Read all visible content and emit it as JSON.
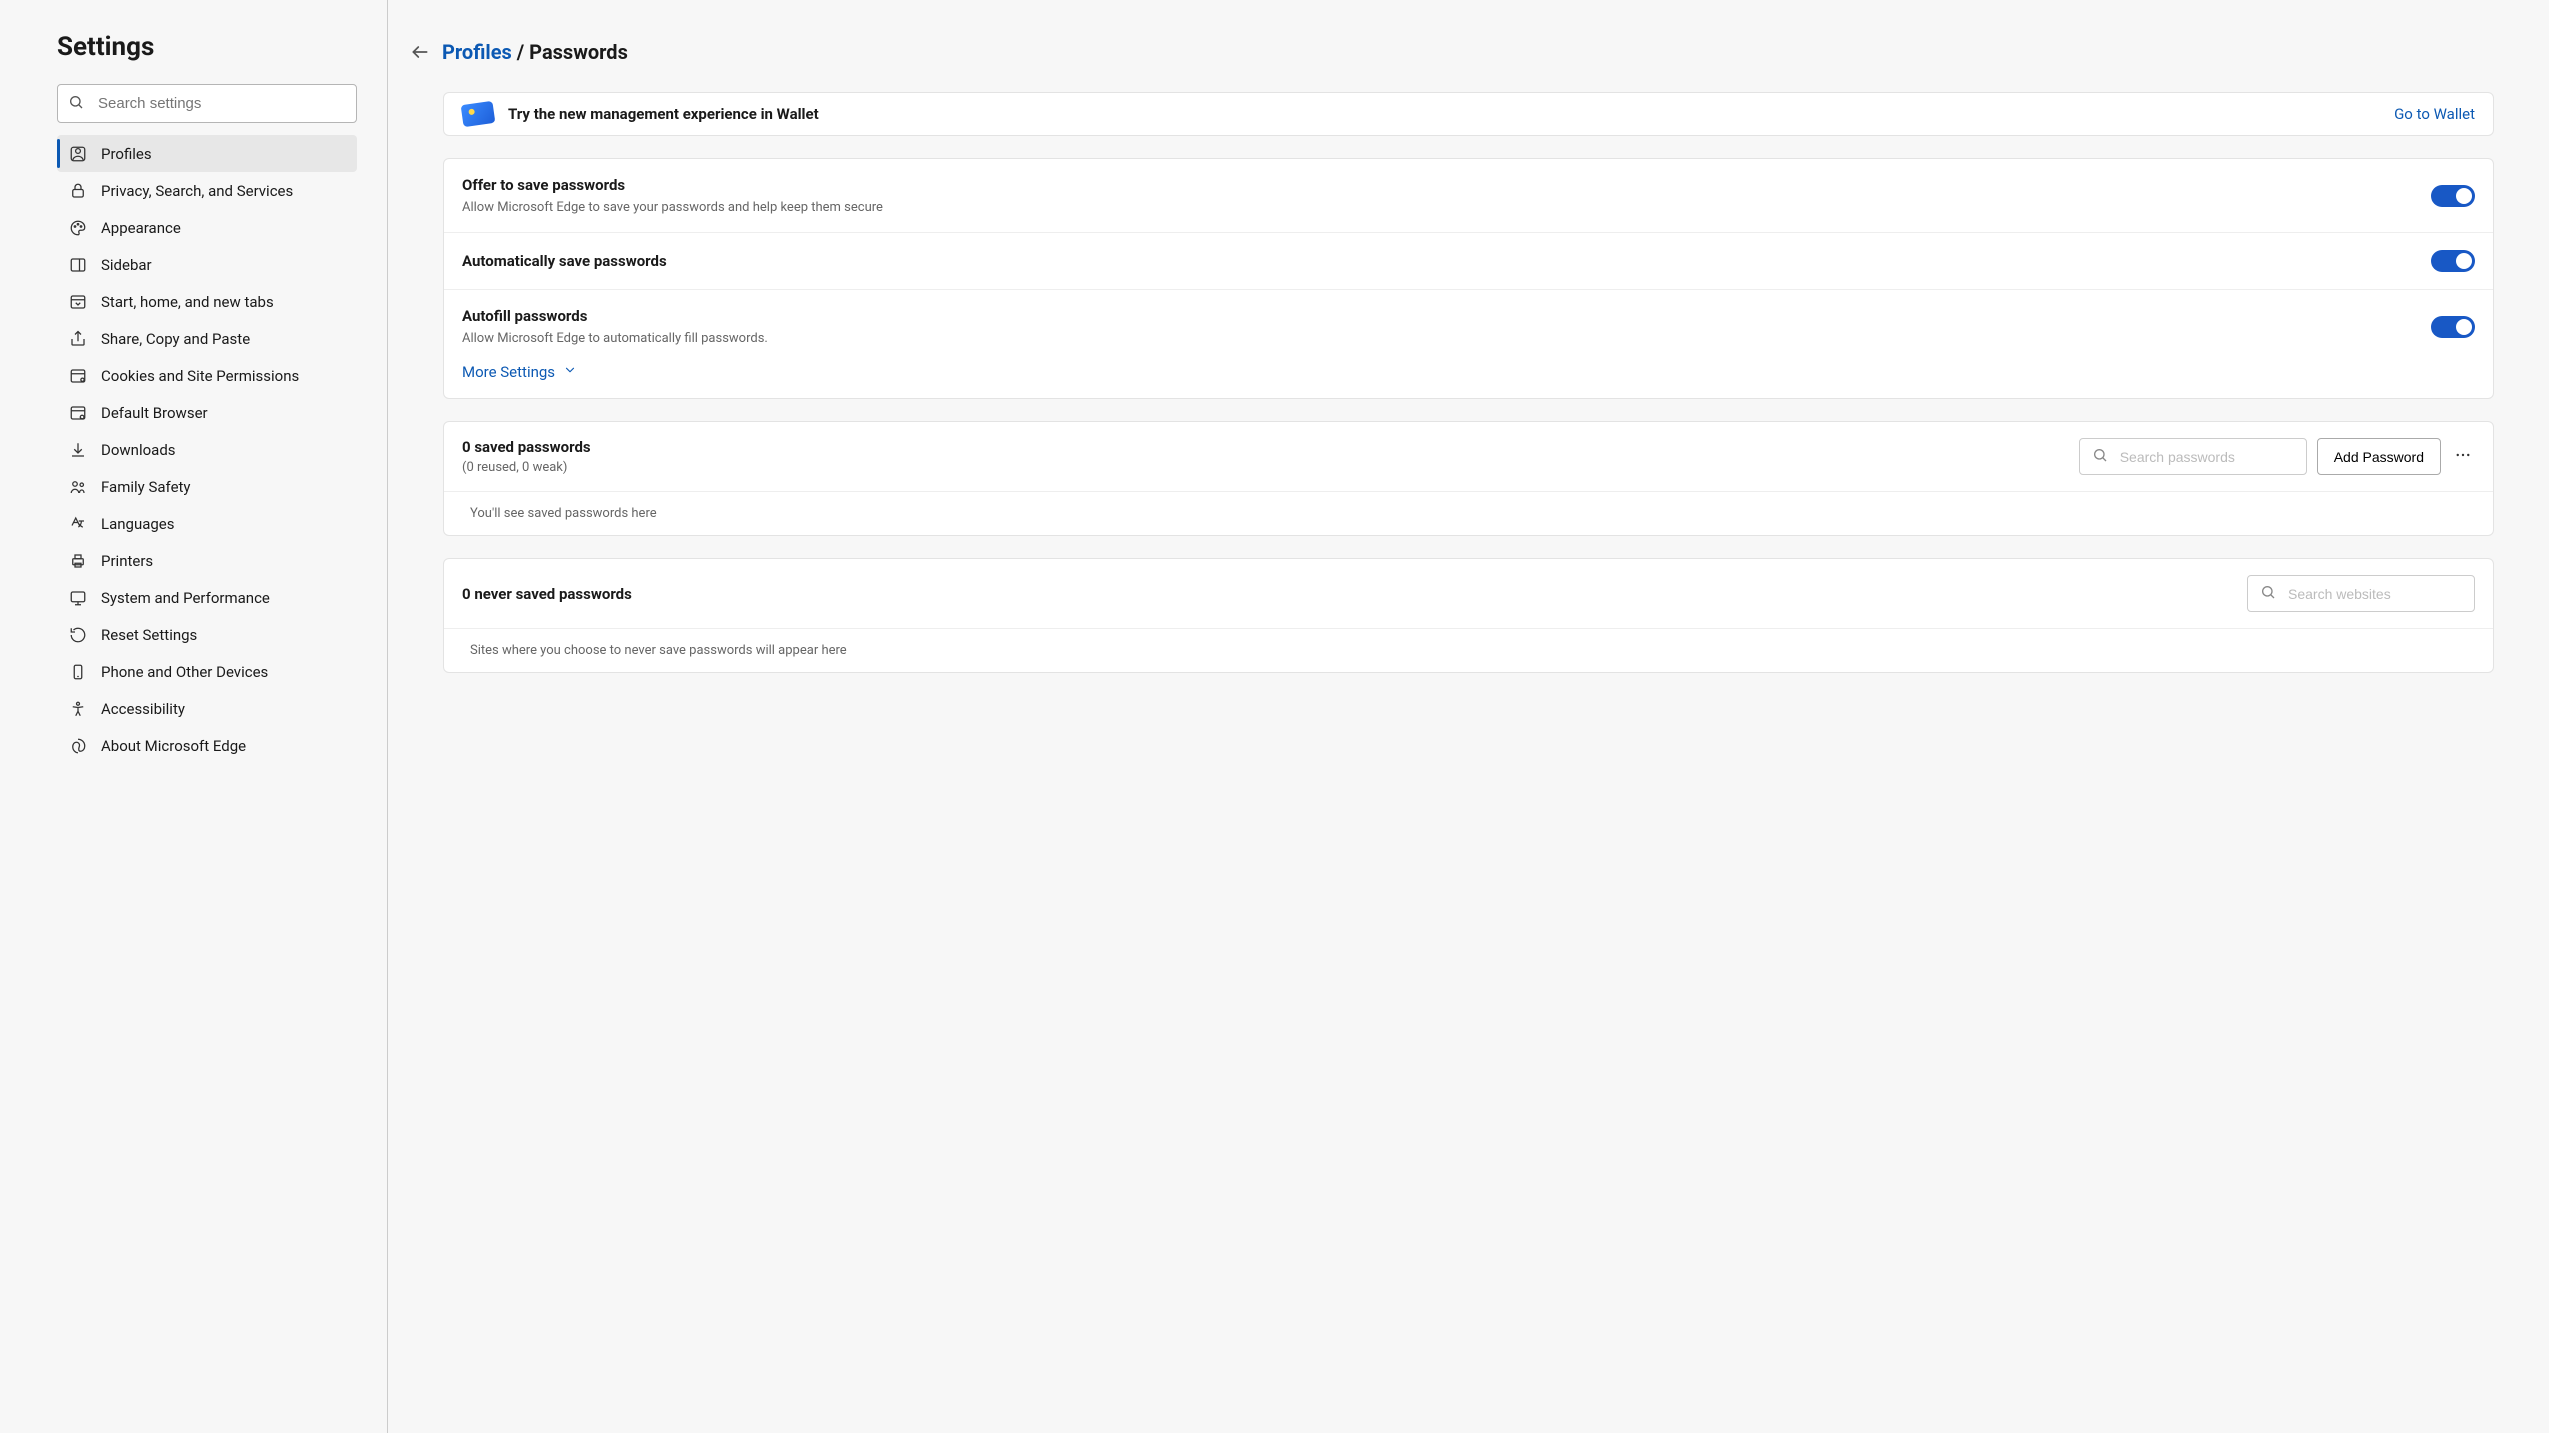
{
  "sidebar": {
    "title": "Settings",
    "search_placeholder": "Search settings",
    "items": [
      {
        "id": "profiles",
        "label": "Profiles",
        "active": true
      },
      {
        "id": "privacy",
        "label": "Privacy, Search, and Services"
      },
      {
        "id": "appearance",
        "label": "Appearance"
      },
      {
        "id": "sidebar",
        "label": "Sidebar"
      },
      {
        "id": "start",
        "label": "Start, home, and new tabs"
      },
      {
        "id": "share",
        "label": "Share, Copy and Paste"
      },
      {
        "id": "cookies",
        "label": "Cookies and Site Permissions"
      },
      {
        "id": "default-browser",
        "label": "Default Browser"
      },
      {
        "id": "downloads",
        "label": "Downloads"
      },
      {
        "id": "family",
        "label": "Family Safety"
      },
      {
        "id": "languages",
        "label": "Languages"
      },
      {
        "id": "printers",
        "label": "Printers"
      },
      {
        "id": "system",
        "label": "System and Performance"
      },
      {
        "id": "reset",
        "label": "Reset Settings"
      },
      {
        "id": "phone",
        "label": "Phone and Other Devices"
      },
      {
        "id": "accessibility",
        "label": "Accessibility"
      },
      {
        "id": "about",
        "label": "About Microsoft Edge"
      }
    ]
  },
  "breadcrumb": {
    "parent_label": "Profiles",
    "separator": " / ",
    "current_label": "Passwords"
  },
  "banner": {
    "text": "Try the new management experience in Wallet",
    "link": "Go to Wallet"
  },
  "settings": {
    "offer": {
      "title": "Offer to save passwords",
      "desc": "Allow Microsoft Edge to save your passwords and help keep them secure",
      "on": true
    },
    "auto_save": {
      "title": "Automatically save passwords",
      "on": true
    },
    "autofill": {
      "title": "Autofill passwords",
      "desc": "Allow Microsoft Edge to automatically fill passwords.",
      "on": true
    },
    "more": "More Settings"
  },
  "saved": {
    "title": "0 saved passwords",
    "sub": "(0 reused, 0 weak)",
    "search_placeholder": "Search passwords",
    "add_button": "Add Password",
    "empty": "You'll see saved passwords here"
  },
  "never": {
    "title": "0 never saved passwords",
    "search_placeholder": "Search websites",
    "empty": "Sites where you choose to never save passwords will appear here"
  }
}
